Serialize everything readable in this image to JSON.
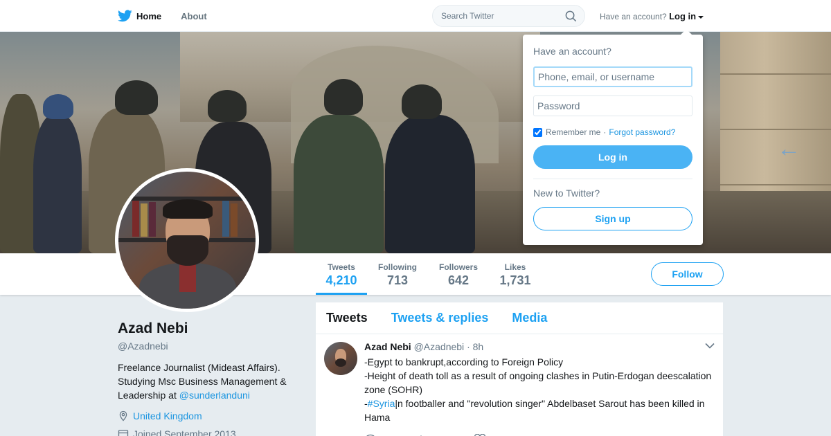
{
  "nav": {
    "home_label": "Home",
    "about_label": "About",
    "search_placeholder": "Search Twitter",
    "have_account": "Have an account?",
    "login_label": "Log in"
  },
  "stats": [
    {
      "label": "Tweets",
      "value": "4,210"
    },
    {
      "label": "Following",
      "value": "713"
    },
    {
      "label": "Followers",
      "value": "642"
    },
    {
      "label": "Likes",
      "value": "1,731"
    }
  ],
  "follow_label": "Follow",
  "profile": {
    "name": "Azad Nebi",
    "handle": "@Azadnebi",
    "bio": "Freelance Journalist (Mideast Affairs). Studying Msc Business Management & Leadership at",
    "bio_link": "@sunderlanduni",
    "location": "United Kingdom",
    "joined": "Joined September 2013"
  },
  "tabs": {
    "tweets": "Tweets",
    "replies": "Tweets & replies",
    "media": "Media"
  },
  "tweet": {
    "name": "Azad Nebi",
    "handle": "@Azadnebi",
    "time": "· 8h",
    "line1": "-Egypt to bankrupt,according to Foreign Policy",
    "line2": "-Height of death toll as a result of ongoing clashes in Putin-Erdogan deescalation zone (SOHR)",
    "line3_prefix": "-",
    "line3_hashtag": "#Syria",
    "line3_rest": "|n footballer and \"revolution singer\" Abdelbaset Sarout has been killed in Hama"
  },
  "dropdown": {
    "question": "Have an account?",
    "username_placeholder": "Phone, email, or username",
    "password_placeholder": "Password",
    "remember": "Remember me",
    "separator": "·",
    "forgot": "Forgot password?",
    "login_button": "Log in",
    "new_to": "New to Twitter?",
    "signup_button": "Sign up"
  },
  "colors": {
    "accent": "#1da1f2",
    "link": "#1b95e0",
    "login_button": "#4ab3f4"
  }
}
